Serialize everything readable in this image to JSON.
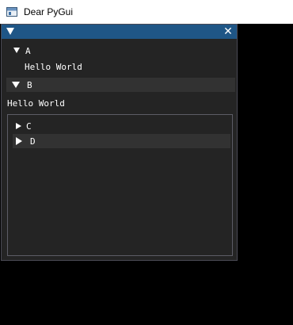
{
  "app": {
    "title": "Dear PyGui"
  },
  "window": {
    "close_glyph": "✕"
  },
  "tree_a": {
    "label": "A",
    "content": "Hello World"
  },
  "header_b": {
    "label": "B",
    "content": "Hello World"
  },
  "child": {
    "tree_c": {
      "label": "C"
    },
    "header_d": {
      "label": "D"
    }
  },
  "colors": {
    "window_bg": "#242424",
    "title_active": "#1f5686",
    "header_bg": "#323232",
    "text": "#ffffff"
  }
}
